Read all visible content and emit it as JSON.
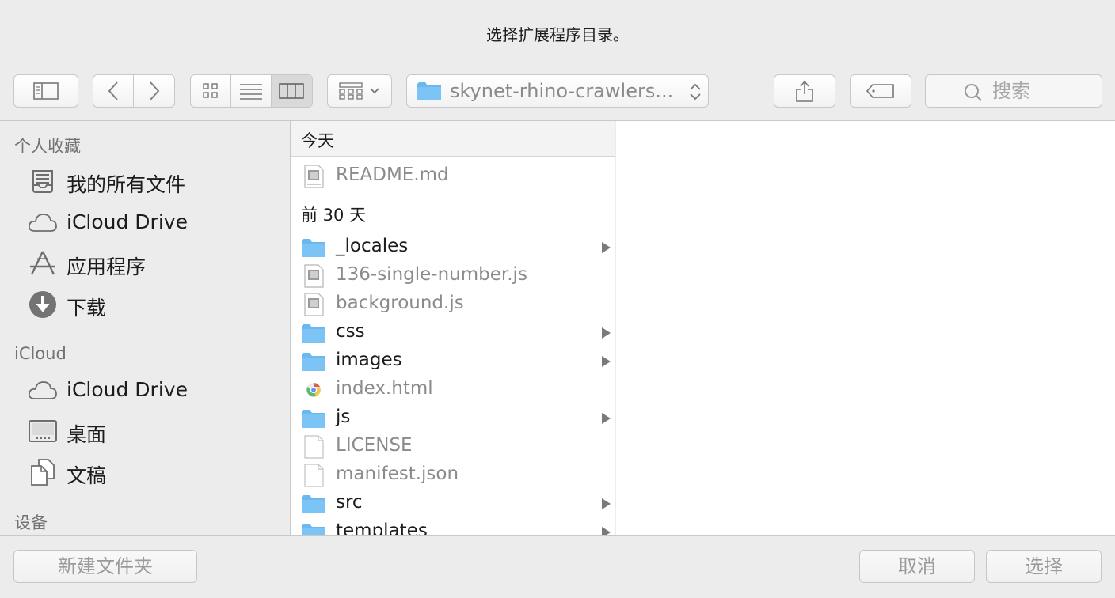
{
  "dialog": {
    "title": "选择扩展程序目录。"
  },
  "toolbar": {
    "path_label": "skynet-rhino-crawlers...",
    "search_placeholder": "搜索",
    "folder_color": "#69b8f0"
  },
  "sidebar": {
    "sections": [
      {
        "title": "个人收藏"
      },
      {
        "title": "iCloud"
      },
      {
        "title": "设备"
      }
    ],
    "favorites": [
      {
        "label": "我的所有文件",
        "icon": "all-files-icon"
      },
      {
        "label": "iCloud Drive",
        "icon": "cloud-icon"
      },
      {
        "label": "应用程序",
        "icon": "applications-icon"
      },
      {
        "label": "下载",
        "icon": "download-icon"
      }
    ],
    "icloud": [
      {
        "label": "iCloud Drive",
        "icon": "cloud-icon"
      },
      {
        "label": "桌面",
        "icon": "desktop-icon"
      },
      {
        "label": "文稿",
        "icon": "documents-icon"
      }
    ]
  },
  "browser": {
    "groups": [
      {
        "title": "今天"
      },
      {
        "title": "前 30 天"
      }
    ],
    "today": [
      {
        "name": "README.md",
        "kind": "file",
        "icon": "markdown-file-icon"
      }
    ],
    "last30": [
      {
        "name": "_locales",
        "kind": "folder",
        "icon": "folder-icon"
      },
      {
        "name": "136-single-number.js",
        "kind": "file",
        "icon": "js-file-icon"
      },
      {
        "name": "background.js",
        "kind": "file",
        "icon": "js-file-icon"
      },
      {
        "name": "css",
        "kind": "folder",
        "icon": "folder-icon"
      },
      {
        "name": "images",
        "kind": "folder",
        "icon": "folder-icon"
      },
      {
        "name": "index.html",
        "kind": "file",
        "icon": "chrome-html-icon"
      },
      {
        "name": "js",
        "kind": "folder",
        "icon": "folder-icon"
      },
      {
        "name": "LICENSE",
        "kind": "file",
        "icon": "blank-file-icon"
      },
      {
        "name": "manifest.json",
        "kind": "file",
        "icon": "blank-file-icon"
      },
      {
        "name": "src",
        "kind": "folder",
        "icon": "folder-icon"
      },
      {
        "name": "templates",
        "kind": "folder",
        "icon": "folder-icon"
      }
    ]
  },
  "footer": {
    "new_folder_label": "新建文件夹",
    "cancel_label": "取消",
    "choose_label": "选择"
  }
}
